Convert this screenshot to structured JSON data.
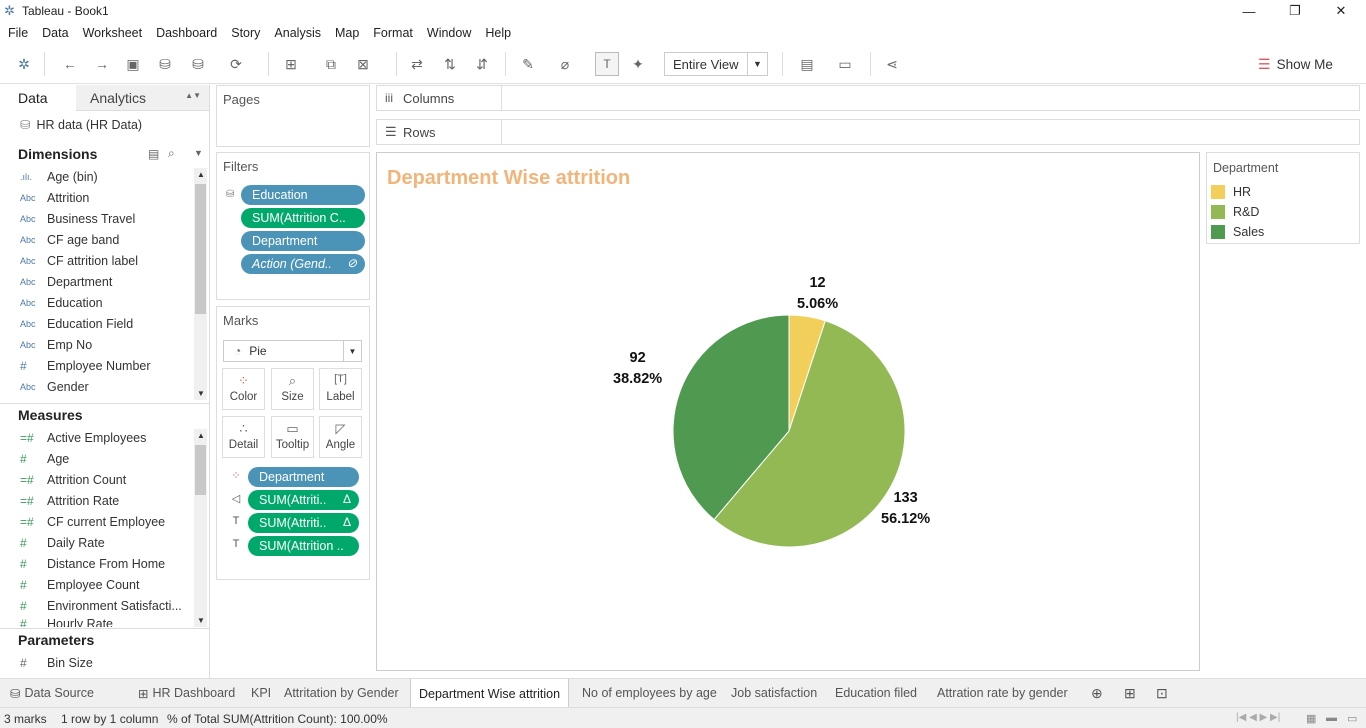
{
  "window": {
    "title": "Tableau - Book1"
  },
  "menu": [
    "File",
    "Data",
    "Worksheet",
    "Dashboard",
    "Story",
    "Analysis",
    "Map",
    "Format",
    "Window",
    "Help"
  ],
  "toolbar": {
    "fit_mode": "Entire View",
    "show_me": "Show Me"
  },
  "left_pane": {
    "tabs": {
      "data": "Data",
      "analytics": "Analytics"
    },
    "datasource": "HR data (HR Data)",
    "dimensions_header": "Dimensions",
    "dimensions": [
      {
        "type": "bin",
        "label": "Age (bin)"
      },
      {
        "type": "Abc",
        "label": "Attrition"
      },
      {
        "type": "Abc",
        "label": "Business Travel"
      },
      {
        "type": "Abc",
        "label": "CF age band"
      },
      {
        "type": "Abc",
        "label": "CF attrition label"
      },
      {
        "type": "Abc",
        "label": "Department"
      },
      {
        "type": "Abc",
        "label": "Education"
      },
      {
        "type": "Abc",
        "label": "Education Field"
      },
      {
        "type": "Abc",
        "label": "Emp No"
      },
      {
        "type": "#",
        "label": "Employee Number"
      },
      {
        "type": "Abc",
        "label": "Gender"
      }
    ],
    "measures_header": "Measures",
    "measures": [
      {
        "type": "=#",
        "label": "Active Employees"
      },
      {
        "type": "#",
        "label": "Age"
      },
      {
        "type": "=#",
        "label": "Attrition Count"
      },
      {
        "type": "=#",
        "label": "Attrition Rate"
      },
      {
        "type": "=#",
        "label": "CF current Employee"
      },
      {
        "type": "#",
        "label": "Daily Rate"
      },
      {
        "type": "#",
        "label": "Distance From Home"
      },
      {
        "type": "#",
        "label": "Employee Count"
      },
      {
        "type": "#",
        "label": "Environment Satisfacti..."
      },
      {
        "type": "#",
        "label": "Hourly Rate"
      }
    ],
    "parameters_header": "Parameters",
    "parameters": [
      {
        "type": "#",
        "label": "Bin Size"
      }
    ]
  },
  "shelves": {
    "pages": "Pages",
    "columns": "Columns",
    "rows": "Rows",
    "filters": "Filters",
    "filter_pills": [
      "Education",
      "SUM(Attrition C..",
      "Department",
      "Action (Gend.."
    ],
    "marks": "Marks",
    "mark_type": "Pie",
    "mark_buttons": [
      "Color",
      "Size",
      "Label",
      "Detail",
      "Tooltip",
      "Angle"
    ],
    "mark_pills": [
      "Department",
      "SUM(Attriti..",
      "SUM(Attriti..",
      "SUM(Attrition .."
    ]
  },
  "view": {
    "sheet_title": "Department Wise attrition"
  },
  "chart_data": {
    "type": "pie",
    "title": "Department Wise attrition",
    "slices": [
      {
        "label": "HR",
        "value": 12,
        "percent": "5.06%",
        "color": "#f2cf5b"
      },
      {
        "label": "R&D",
        "value": 133,
        "percent": "56.12%",
        "color": "#93b955"
      },
      {
        "label": "Sales",
        "value": 92,
        "percent": "38.82%",
        "color": "#4f9a50"
      }
    ]
  },
  "legend": {
    "title": "Department",
    "items": [
      {
        "label": "HR",
        "color": "#f2cf5b"
      },
      {
        "label": "R&D",
        "color": "#93b955"
      },
      {
        "label": "Sales",
        "color": "#4f9a50"
      }
    ]
  },
  "sheet_tabs": [
    "Data Source",
    "HR Dashboard",
    "KPI",
    "Attritation by Gender",
    "Department Wise attrition",
    "No of employees by age",
    "Job satisfaction",
    "Education filed",
    "Attration rate by gender"
  ],
  "active_tab": "Department Wise attrition",
  "status": {
    "marks": "3 marks",
    "dims": "1 row by 1 column",
    "total": "% of Total SUM(Attrition Count): 100.00%"
  }
}
